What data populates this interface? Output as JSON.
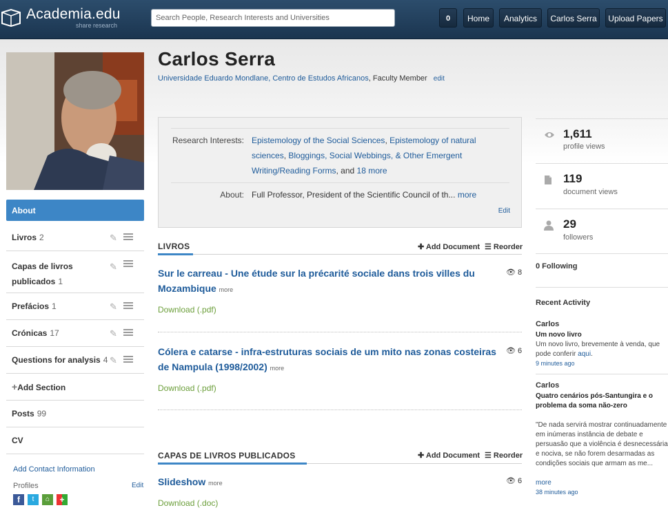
{
  "topbar": {
    "logo_text": "Academia.edu",
    "logo_tagline": "share research",
    "search_placeholder": "Search People, Research Interests and Universities",
    "nav": {
      "count": "0",
      "home": "Home",
      "analytics": "Analytics",
      "profile": "Carlos Serra",
      "upload": "Upload Papers"
    }
  },
  "profile": {
    "name": "Carlos Serra",
    "affiliation": "Universidade Eduardo Mondlane, Centro de Estudos Africanos",
    "position": ", Faculty Member",
    "edit": "edit",
    "research_label": "Research Interests:",
    "interests": [
      "Epistemology of the Social Sciences",
      "Epistemology of natural sciences",
      "Bloggings, Social Webbings, & Other Emergent Writing/Reading Forms"
    ],
    "interests_and": ", and",
    "interests_more": "18 more",
    "about_label": "About:",
    "about_text": "Full Professor, President of the Scientific Council of th...",
    "about_more": "more",
    "box_edit": "Edit"
  },
  "sidebar": {
    "items": [
      {
        "label": "About",
        "count": ""
      },
      {
        "label": "Livros",
        "count": "2"
      },
      {
        "label": "Capas de livros publicados",
        "count": "1"
      },
      {
        "label": "Prefácios",
        "count": "1"
      },
      {
        "label": "Crónicas",
        "count": "17"
      },
      {
        "label": "Questions for analysis",
        "count": "4"
      },
      {
        "label": "Add Section",
        "count": ""
      },
      {
        "label": "Posts",
        "count": "99"
      },
      {
        "label": "CV",
        "count": ""
      }
    ],
    "add_contact": "Add Contact Information",
    "profiles_label": "Profiles",
    "profiles_edit": "Edit"
  },
  "sections": [
    {
      "title": "LIVROS",
      "add_document": "Add Document",
      "reorder": "Reorder",
      "papers": [
        {
          "title": "Sur le carreau - Une étude sur la précarité sociale dans trois villes du Mozambique",
          "more": "more",
          "download": "Download (.pdf)",
          "views": "8"
        },
        {
          "title": "Cólera e catarse - infra-estruturas sociais de um mito nas zonas costeiras de Nampula (1998/2002)",
          "more": "more",
          "download": "Download (.pdf)",
          "views": "6"
        }
      ]
    },
    {
      "title": "CAPAS DE LIVROS PUBLICADOS",
      "add_document": "Add Document",
      "reorder": "Reorder",
      "papers": [
        {
          "title": "Slideshow",
          "more": "more",
          "download": "Download (.doc)",
          "views": "6"
        }
      ]
    }
  ],
  "stats": [
    {
      "value": "1,611",
      "label": "profile views",
      "icon": "eye-icon"
    },
    {
      "value": "119",
      "label": "document views",
      "icon": "document-icon"
    },
    {
      "value": "29",
      "label": "followers",
      "icon": "person-icon"
    }
  ],
  "following": "0 Following",
  "recent_activity": {
    "heading": "Recent Activity",
    "items": [
      {
        "name": "Carlos",
        "title": "Um novo livro",
        "text": "Um novo livro, brevemente à venda, que pode conferir",
        "link": "aqui",
        "link_suffix": ".",
        "time": "9 minutes ago"
      },
      {
        "name": "Carlos",
        "title": "Quatro cenários pós-Santungira e o problema da soma não-zero",
        "text": "\"De nada servirá mostrar continuadamente em inúmeras instância de debate e persuasão que a violência é desnecessária e nociva, se não forem desarmadas as condições sociais que armam as me...",
        "more": "more",
        "time": "38 minutes ago"
      }
    ]
  },
  "colors": {
    "topbar": "#1f3b57",
    "accent": "#3d86c6",
    "link": "#1e5b9a",
    "download": "#6b9e3a"
  }
}
